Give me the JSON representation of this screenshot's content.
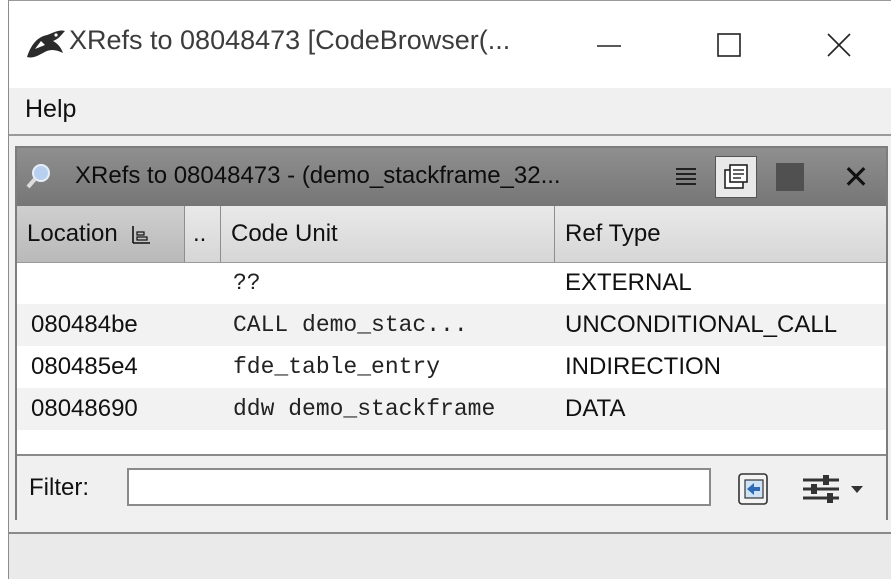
{
  "window": {
    "title": "XRefs to 08048473 [CodeBrowser(..."
  },
  "menu": {
    "items": [
      "Help"
    ]
  },
  "panel": {
    "title": "XRefs to 08048473 - (demo_stackframe_32...",
    "close_glyph": "✕"
  },
  "table": {
    "headers": {
      "location": "Location",
      "dots": "..",
      "code_unit": "Code Unit",
      "ref_type": "Ref Type"
    },
    "rows": [
      {
        "location": "",
        "code_unit": "??",
        "ref_type": "EXTERNAL"
      },
      {
        "location": "080484be",
        "code_unit": "CALL demo_stac...",
        "ref_type": "UNCONDITIONAL_CALL"
      },
      {
        "location": "080485e4",
        "code_unit": "fde_table_entry",
        "ref_type": "INDIRECTION"
      },
      {
        "location": "08048690",
        "code_unit": "ddw demo_stackframe",
        "ref_type": "DATA"
      }
    ]
  },
  "filter": {
    "label": "Filter:",
    "value": ""
  },
  "icons": {
    "app": "dragon-icon",
    "search": "magnifier-icon",
    "list": "list-lines-icon",
    "snapshot": "snapshot-icon",
    "square": "square-icon",
    "close": "close-icon",
    "sort": "sort-icon",
    "filter_action": "filter-action-icon",
    "filter_options": "sliders-icon"
  },
  "colors": {
    "panel_header": "#828282",
    "table_header": "#dedede",
    "alt_row": "#f2f2f2"
  }
}
